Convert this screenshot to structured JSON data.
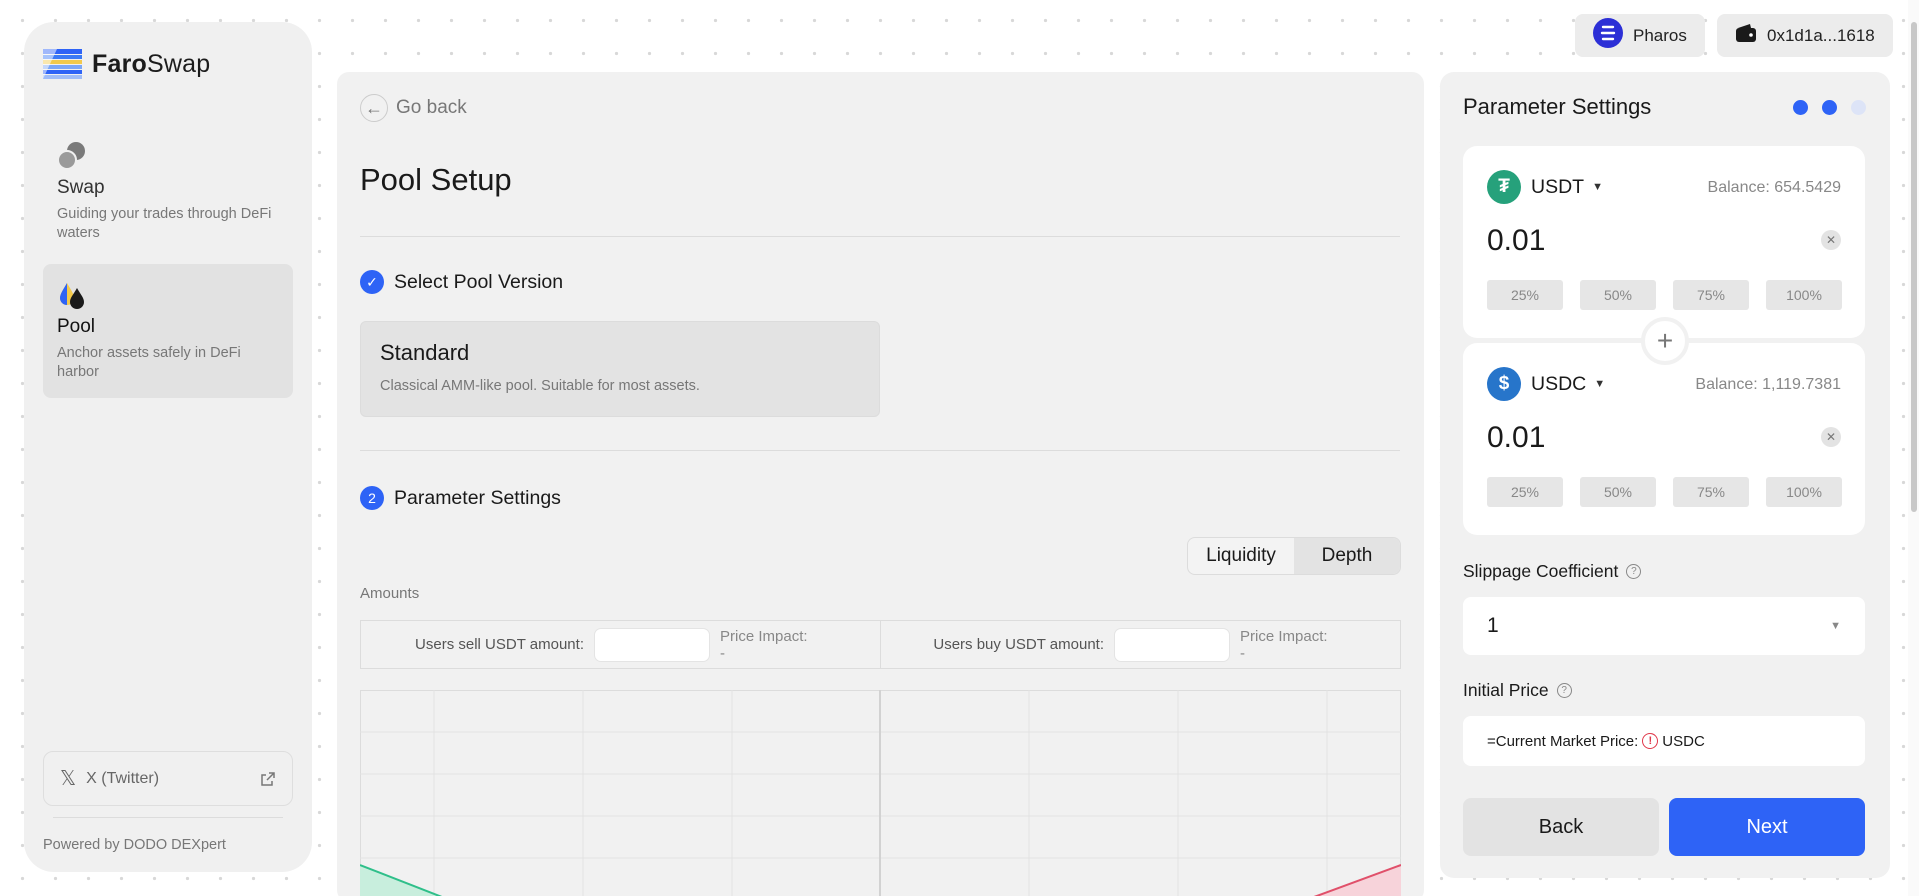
{
  "app": {
    "logo_bold": "Faro",
    "logo_regular": "Swap"
  },
  "sidebar": {
    "items": [
      {
        "title": "Swap",
        "desc": "Guiding your trades through DeFi waters",
        "icon": "coins-icon"
      },
      {
        "title": "Pool",
        "desc": "Anchor assets safely in DeFi harbor",
        "icon": "droplets-icon"
      }
    ],
    "twitter_label": "X (Twitter)",
    "powered_by": "Powered by DODO DEXpert"
  },
  "topbar": {
    "network_label": "Pharos",
    "wallet_label": "0x1d1a...1618"
  },
  "main": {
    "go_back": "Go back",
    "page_title": "Pool Setup",
    "step1_label": "Select Pool Version",
    "standard_title": "Standard",
    "standard_desc": "Classical AMM-like pool. Suitable for most assets.",
    "step2_number": "2",
    "step2_label": "Parameter Settings",
    "toggle": {
      "liquidity": "Liquidity",
      "depth": "Depth",
      "selected": "Depth"
    },
    "amounts_label": "Amounts",
    "sell_label": "Users sell USDT amount:",
    "buy_label": "Users buy USDT amount:",
    "sell_impact": "Price Impact: -",
    "buy_impact": "Price Impact: -"
  },
  "panel": {
    "title": "Parameter Settings",
    "progress": {
      "total": 3,
      "active": 2
    },
    "token_a": {
      "symbol": "USDT",
      "balance": "Balance: 654.5429",
      "amount": "0.01",
      "color": "#26a17b"
    },
    "token_b": {
      "symbol": "USDC",
      "balance": "Balance: 1,119.7381",
      "amount": "0.01",
      "color": "#2775ca"
    },
    "percents": [
      "25%",
      "50%",
      "75%",
      "100%"
    ],
    "slippage_label": "Slippage Coefficient",
    "slippage_value": "1",
    "initial_price_label": "Initial Price",
    "price_prefix": "=Current Market Price:",
    "price_unit": "USDC",
    "back_label": "Back",
    "next_label": "Next"
  },
  "colors": {
    "accent": "#2e63f6",
    "bid": "#2fbf8a",
    "ask": "#e0506a"
  }
}
